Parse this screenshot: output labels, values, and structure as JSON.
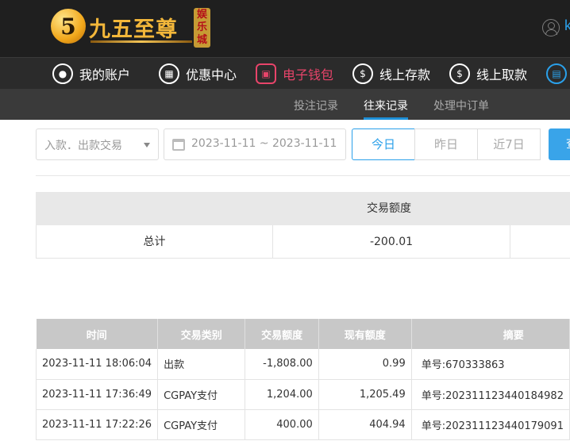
{
  "brand": {
    "logo_numeral": "5",
    "logo_text": "九五至尊",
    "logo_badge": "娱乐城",
    "user_initial": "k"
  },
  "main_nav": [
    {
      "label": "我的账户",
      "icon": "user-circle-icon"
    },
    {
      "label": "优惠中心",
      "icon": "gift-icon"
    },
    {
      "label": "电子钱包",
      "icon": "wallet-icon",
      "active": true
    },
    {
      "label": "线上存款",
      "icon": "deposit-icon"
    },
    {
      "label": "线上取款",
      "icon": "withdraw-icon"
    }
  ],
  "sub_nav": [
    {
      "label": "投注记录"
    },
    {
      "label": "往来记录",
      "active": true
    },
    {
      "label": "处理中订单"
    }
  ],
  "filters": {
    "type_select": "入款．出款交易",
    "date_range": "2023-11-11 ~ 2023-11-11",
    "quick_ranges": [
      "今日",
      "昨日",
      "近7日"
    ],
    "search_label": "查"
  },
  "summary": {
    "header": "交易额度",
    "total_label": "总计",
    "total_value": "-200.01"
  },
  "records": {
    "columns": [
      "时间",
      "交易类别",
      "交易额度",
      "现有额度",
      "摘要"
    ],
    "rows": [
      {
        "time": "2023-11-11 18:06:04",
        "type": "出款",
        "amount": "-1,808.00",
        "balance": "0.99",
        "note": "单号:670333863"
      },
      {
        "time": "2023-11-11 17:36:49",
        "type": "CGPAY支付",
        "amount": "1,204.00",
        "balance": "1,205.49",
        "note": "单号:202311123440184982"
      },
      {
        "time": "2023-11-11 17:22:26",
        "type": "CGPAY支付",
        "amount": "400.00",
        "balance": "404.94",
        "note": "单号:202311123440179091"
      }
    ]
  },
  "colors": {
    "accent_blue": "#2aa0ea",
    "active_pink": "#e8446a",
    "gold": "#f3b73a"
  }
}
